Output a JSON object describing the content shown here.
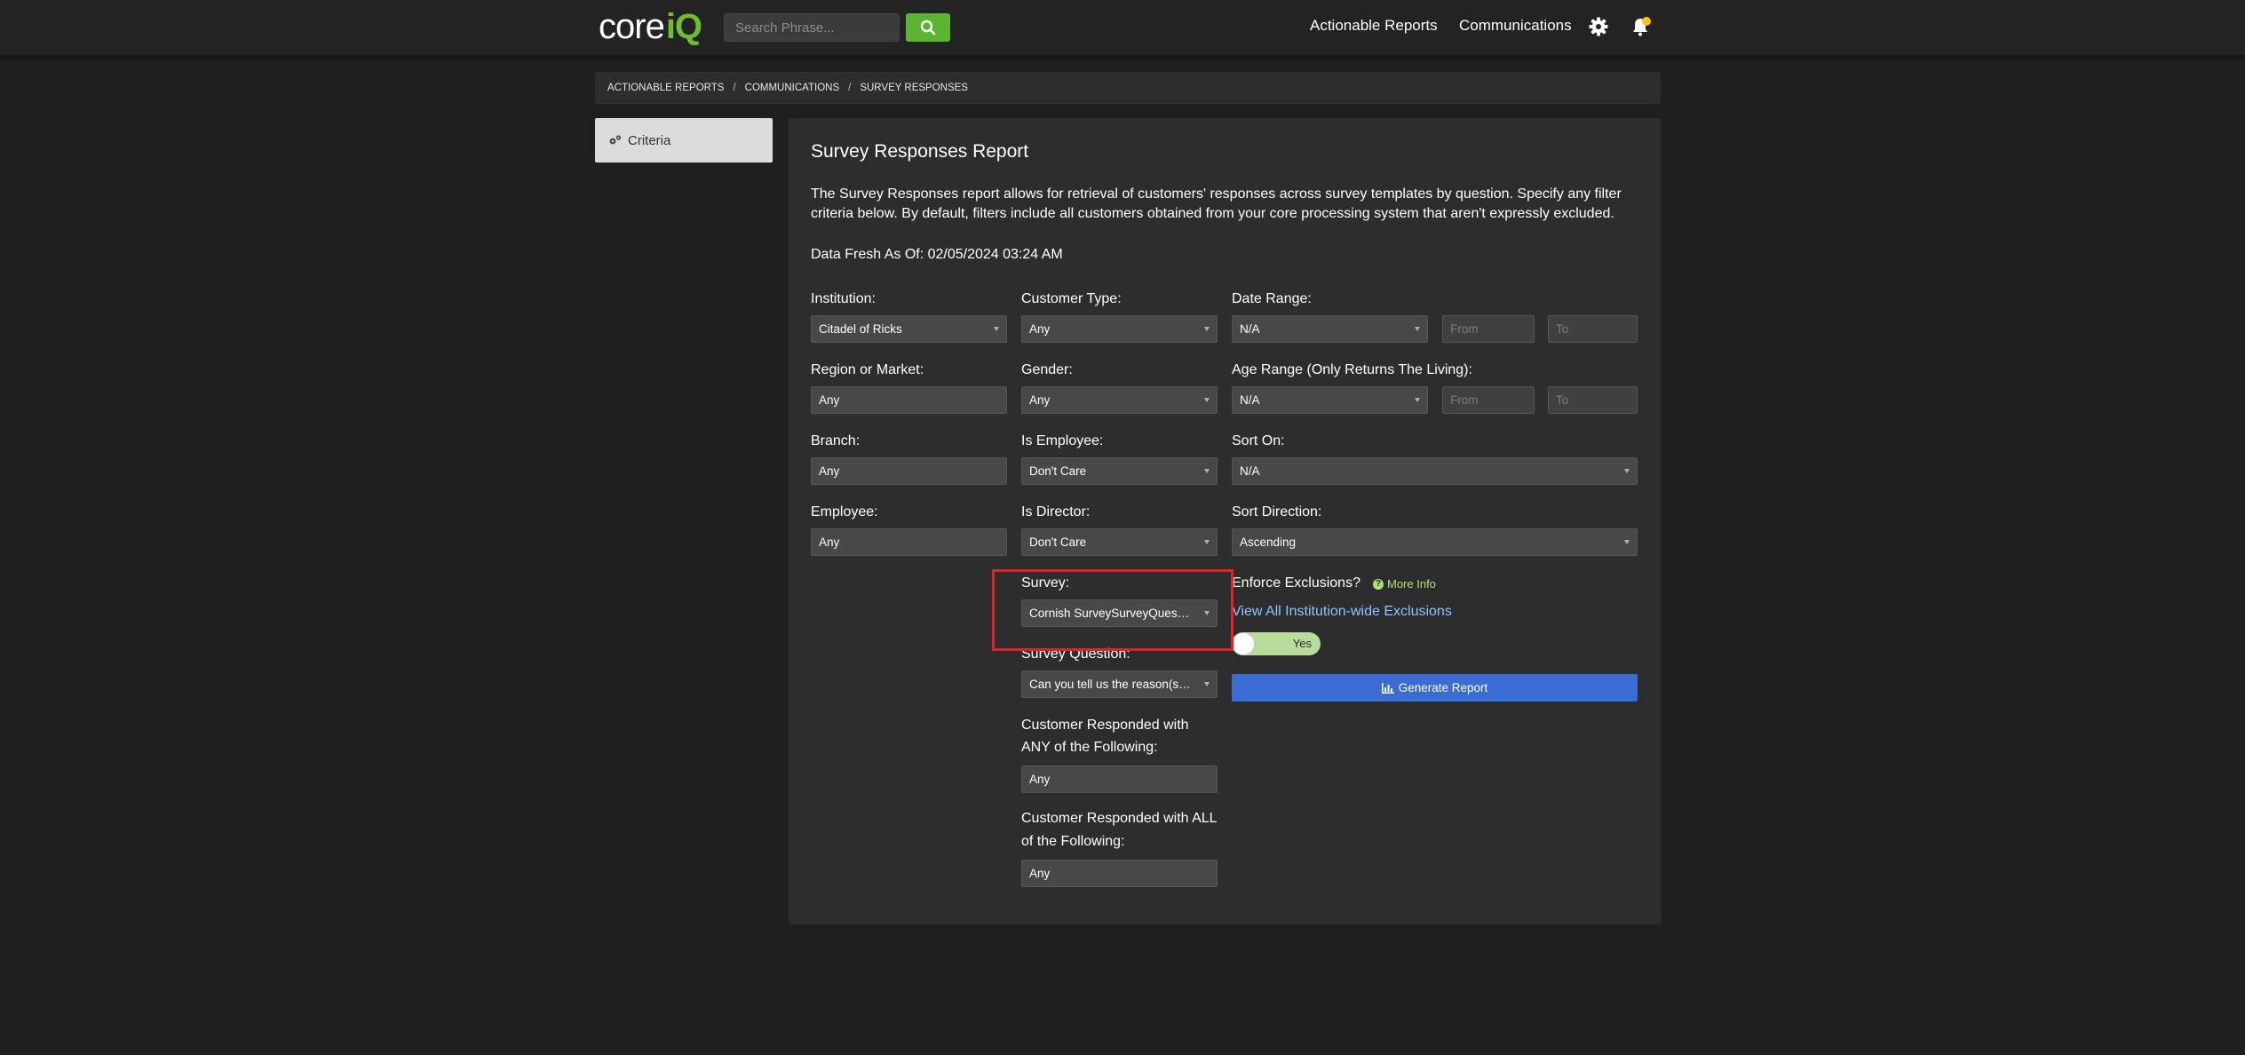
{
  "header": {
    "logo_core": "core",
    "logo_iq": "iQ",
    "search_placeholder": "Search Phrase...",
    "nav": [
      "Actionable Reports",
      "Communications"
    ],
    "icons": [
      "search-icon",
      "gear-icon",
      "bell-icon"
    ],
    "accent": "#5cb531"
  },
  "breadcrumb": [
    "ACTIONABLE REPORTS",
    "COMMUNICATIONS",
    "SURVEY RESPONSES"
  ],
  "sidebar": {
    "criteria_label": "Criteria"
  },
  "report": {
    "title": "Survey Responses Report",
    "description": "The Survey Responses report allows for retrieval of customers' responses across survey templates by question. Specify any filter criteria below. By default, filters include all customers obtained from your core processing system that aren't expressly excluded.",
    "freshness": "Data Fresh As Of: 02/05/2024 03:24 AM"
  },
  "form": {
    "institution": {
      "label": "Institution:",
      "value": "Citadel of Ricks"
    },
    "customer_type": {
      "label": "Customer Type:",
      "value": "Any"
    },
    "date_range": {
      "label": "Date Range:",
      "value": "N/A",
      "from_placeholder": "From",
      "to_placeholder": "To"
    },
    "region": {
      "label": "Region or Market:",
      "value": "Any"
    },
    "gender": {
      "label": "Gender:",
      "value": "Any"
    },
    "age_range": {
      "label": "Age Range (Only Returns The Living):",
      "value": "N/A",
      "from_placeholder": "From",
      "to_placeholder": "To"
    },
    "branch": {
      "label": "Branch:",
      "value": "Any"
    },
    "is_employee": {
      "label": "Is Employee:",
      "value": "Don't Care"
    },
    "sort_on": {
      "label": "Sort On:",
      "value": "N/A"
    },
    "employee": {
      "label": "Employee:",
      "value": "Any"
    },
    "is_director": {
      "label": "Is Director:",
      "value": "Don't Care"
    },
    "sort_direction": {
      "label": "Sort Direction:",
      "value": "Ascending"
    },
    "survey": {
      "label": "Survey:",
      "value": "Cornish SurveySurveyQuestions"
    },
    "survey_question": {
      "label": "Survey Question:",
      "value": "Can you tell us the reason(s) for your visit?"
    },
    "responded_any": {
      "label_line1": "Customer Responded with",
      "label_line2": "ANY of the Following:",
      "value": "Any"
    },
    "responded_all": {
      "label_line1": "Customer Responded with ALL",
      "label_line2": "of the Following:",
      "value": "Any"
    },
    "enforce_exclusions": {
      "label": "Enforce Exclusions?",
      "more_info": "More Info",
      "link": "View All Institution-wide Exclusions",
      "toggle_label": "Yes",
      "toggle_on": true
    },
    "generate_label": "Generate Report"
  }
}
